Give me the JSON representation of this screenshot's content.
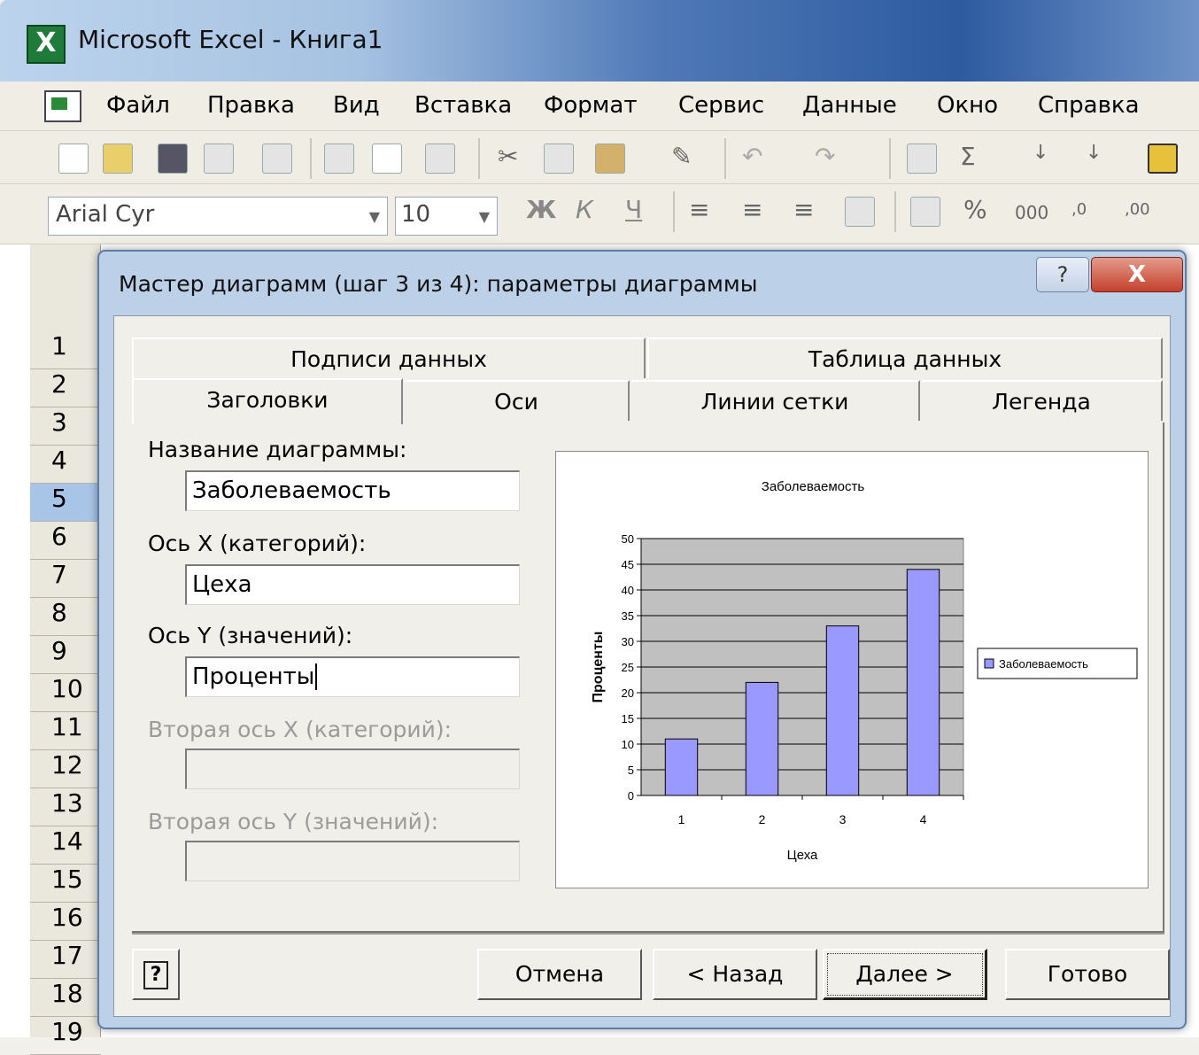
{
  "window": {
    "title": "Microsoft Excel - Книга1"
  },
  "menu": [
    "Файл",
    "Правка",
    "Вид",
    "Вставка",
    "Формат",
    "Сервис",
    "Данные",
    "Окно",
    "Справка"
  ],
  "formatting": {
    "font": "Arial Cyr",
    "size": "10"
  },
  "rows": [
    "1",
    "2",
    "3",
    "4",
    "5",
    "6",
    "7",
    "8",
    "9",
    "10",
    "11",
    "12",
    "13",
    "14",
    "15",
    "16",
    "17",
    "18",
    "19"
  ],
  "dialog": {
    "title": "Мастер диаграмм (шаг 3 из 4): параметры диаграммы",
    "help_glyph": "?",
    "close_glyph": "X",
    "tabs_back": [
      "Подписи данных",
      "Таблица данных"
    ],
    "tabs_front": [
      "Заголовки",
      "Оси",
      "Линии сетки",
      "Легенда"
    ],
    "fields": {
      "chart_title_label": "Название диаграммы:",
      "chart_title_value": "Заболеваемость",
      "x_axis_label": "Ось X (категорий):",
      "x_axis_value": "Цеха",
      "y_axis_label": "Ось Y (значений):",
      "y_axis_value": "Проценты",
      "x2_axis_label": "Вторая ось X (категорий):",
      "y2_axis_label": "Вторая ось Y (значений):"
    },
    "buttons": {
      "help": "?",
      "cancel": "Отмена",
      "back": "< Назад",
      "next": "Далее >",
      "finish": "Готово"
    }
  },
  "chart_data": {
    "type": "bar",
    "title": "Заболеваемость",
    "xlabel": "Цеха",
    "ylabel": "Проценты",
    "categories": [
      "1",
      "2",
      "3",
      "4"
    ],
    "series": [
      {
        "name": "Заболеваемость",
        "values": [
          11,
          22,
          33,
          44
        ]
      }
    ],
    "ylim": [
      0,
      50
    ],
    "yticks": [
      "0",
      "5",
      "10",
      "15",
      "20",
      "25",
      "30",
      "35",
      "40",
      "45",
      "50"
    ],
    "legend": "right",
    "grid": true,
    "colors": {
      "bar": "#9999ff",
      "plot_bg": "#c0c0c0"
    }
  }
}
